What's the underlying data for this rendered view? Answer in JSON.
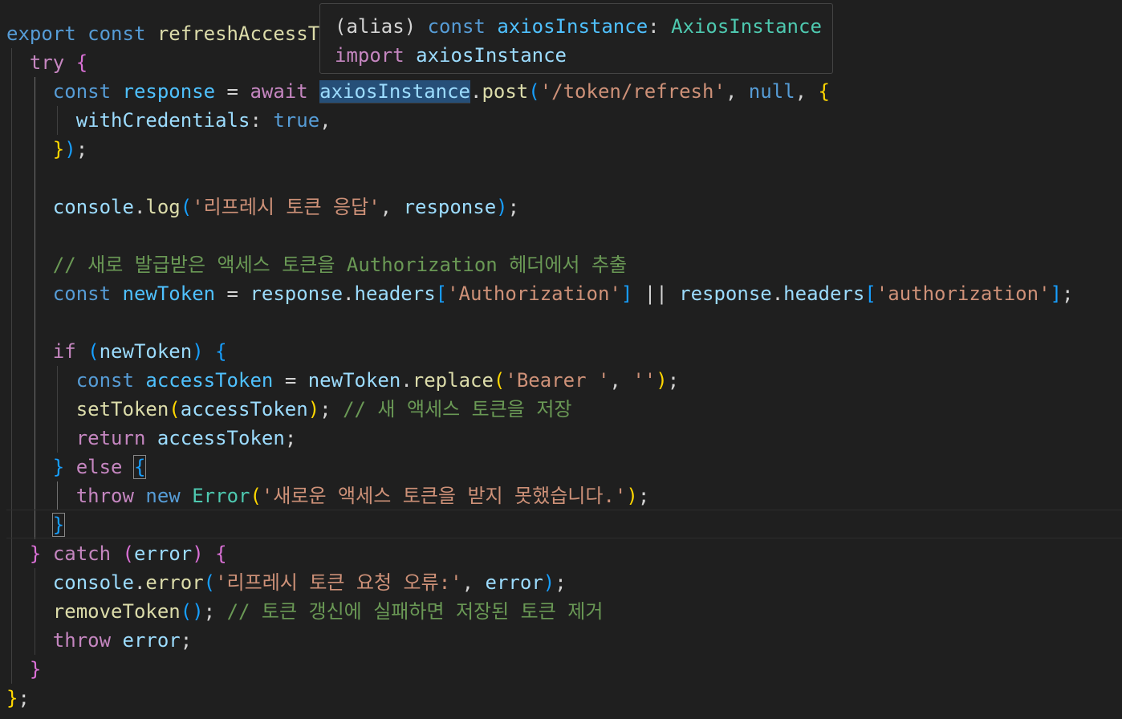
{
  "hover": {
    "line1": {
      "alias": "(alias)",
      "const": "const",
      "name": "axiosInstance",
      "colon": ":",
      "type": "AxiosInstance"
    },
    "line2": {
      "import": "import",
      "name": "axiosInstance"
    }
  },
  "code": {
    "l01": {
      "export": "export",
      "const": "const",
      "name": "refreshAccessT"
    },
    "l02": {
      "try": "try",
      "brace": "{"
    },
    "l03": {
      "const": "const",
      "response": "response",
      "eq": "=",
      "await": "await",
      "instance": "axiosInstance",
      "dot": ".",
      "post": "post",
      "lp": "(",
      "url": "'/token/refresh'",
      "comma1": ",",
      "null": "null",
      "comma2": ",",
      "brace": "{"
    },
    "l04": {
      "prop": "withCredentials",
      "colon": ":",
      "val": "true",
      "comma": ","
    },
    "l05": {
      "rbrace": "}",
      "rparen": ")",
      "semi": ";"
    },
    "l07": {
      "console": "console",
      "dot": ".",
      "log": "log",
      "lp": "(",
      "str": "'리프레시 토큰 응답'",
      "comma": ",",
      "response": "response",
      "rp": ")",
      "semi": ";"
    },
    "l09": {
      "comment": "// 새로 발급받은 액세스 토큰을 Authorization 헤더에서 추출"
    },
    "l10": {
      "const": "const",
      "newToken": "newToken",
      "eq": "=",
      "resp1": "response",
      "dot1": ".",
      "headers1": "headers",
      "lb1": "[",
      "key1": "'Authorization'",
      "rb1": "]",
      "or": "||",
      "resp2": "response",
      "dot2": ".",
      "headers2": "headers",
      "lb2": "[",
      "key2": "'authorization'",
      "rb2": "]",
      "semi": ";"
    },
    "l12": {
      "if": "if",
      "lp": "(",
      "newToken": "newToken",
      "rp": ")",
      "brace": "{"
    },
    "l13": {
      "const": "const",
      "accessToken": "accessToken",
      "eq": "=",
      "newToken": "newToken",
      "dot": ".",
      "replace": "replace",
      "lp": "(",
      "arg1": "'Bearer '",
      "comma": ",",
      "arg2": "''",
      "rp": ")",
      "semi": ";"
    },
    "l14": {
      "setToken": "setToken",
      "lp": "(",
      "accessToken": "accessToken",
      "rp": ")",
      "semi": ";",
      "comment": "// 새 액세스 토큰을 저장"
    },
    "l15": {
      "return": "return",
      "accessToken": "accessToken",
      "semi": ";"
    },
    "l16": {
      "rbrace": "}",
      "else": "else",
      "lbrace": "{"
    },
    "l17": {
      "throw": "throw",
      "new": "new",
      "error": "Error",
      "lp": "(",
      "msg": "'새로운 액세스 토큰을 받지 못했습니다.'",
      "rp": ")",
      "semi": ";"
    },
    "l18": {
      "rbrace": "}"
    },
    "l19": {
      "rbrace": "}",
      "catch": "catch",
      "lp": "(",
      "error": "error",
      "rp": ")",
      "lbrace": "{"
    },
    "l20": {
      "console": "console",
      "dot": ".",
      "errorFn": "error",
      "lp": "(",
      "str": "'리프레시 토큰 요청 오류:'",
      "comma": ",",
      "error": "error",
      "rp": ")",
      "semi": ";"
    },
    "l21": {
      "removeToken": "removeToken",
      "parens": "()",
      "semi": ";",
      "comment": "// 토큰 갱신에 실패하면 저장된 토큰 제거"
    },
    "l22": {
      "throw": "throw",
      "error": "error",
      "semi": ";"
    },
    "l23": {
      "rbrace": "}"
    },
    "l24": {
      "rbrace": "}",
      "semi": ";"
    }
  },
  "colors": {
    "background": "#1f1f1f",
    "keyword_control": "#c586c0",
    "keyword_storage": "#569cd6",
    "function": "#dcdcaa",
    "variable": "#9cdcfe",
    "constant": "#4fc1ff",
    "string": "#ce9178",
    "comment": "#6a9955",
    "type": "#4ec9b0",
    "bracket_level1": "#ffd700",
    "bracket_level2": "#da70d6",
    "bracket_level3": "#179fff"
  }
}
